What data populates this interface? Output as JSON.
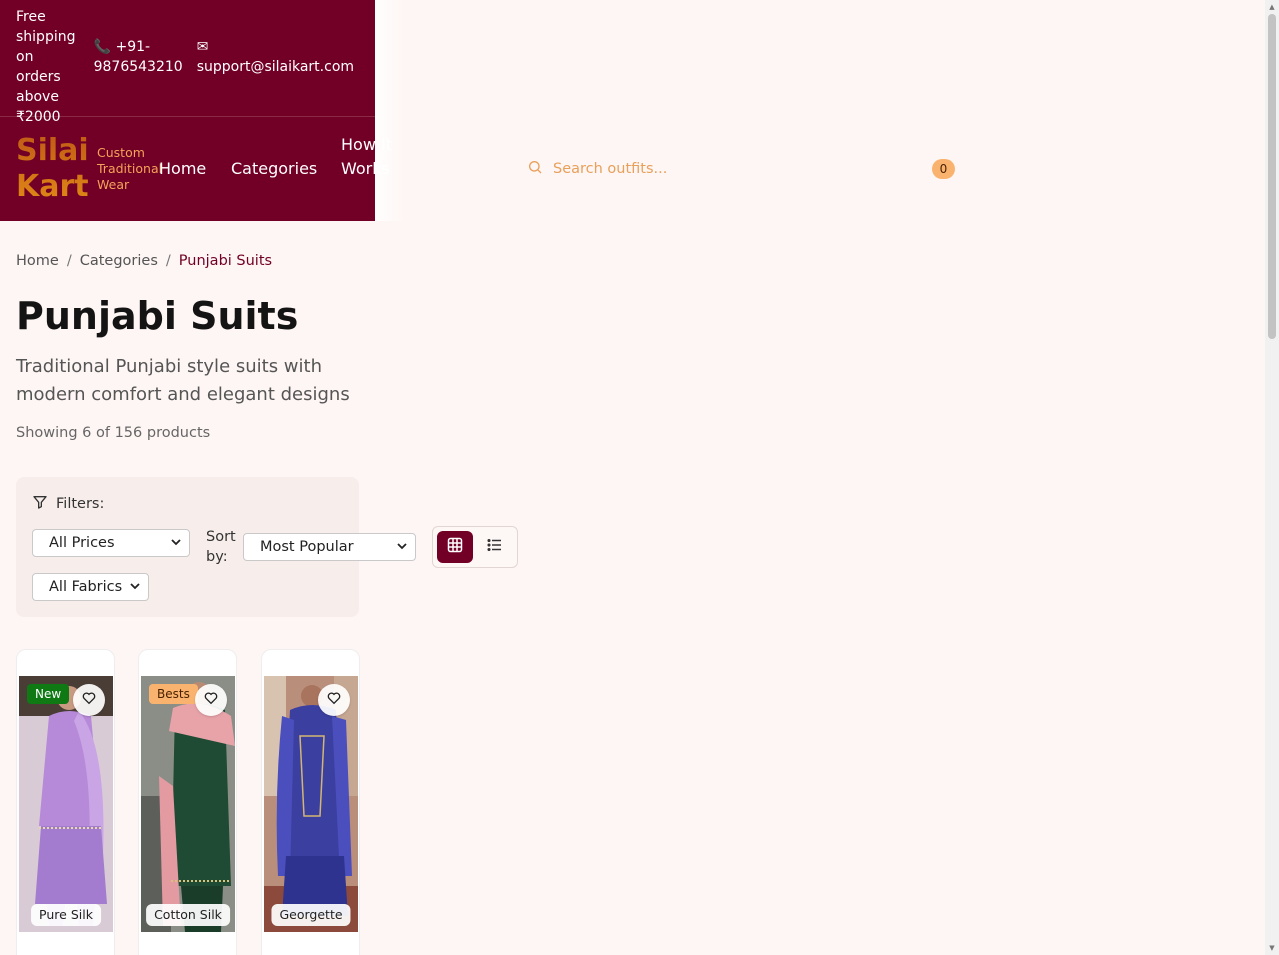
{
  "topbar": {
    "shipping": "Free shipping on orders above ₹2000",
    "phone": "📞 +91-9876543210",
    "email": "✉ support@silaikart.com"
  },
  "brand": {
    "name": "Silai Kart",
    "tagline": "Custom Traditional Wear"
  },
  "nav": {
    "home": "Home",
    "categories": "Categories",
    "how": "How It Works"
  },
  "search": {
    "placeholder": "Search outfits..."
  },
  "cart": {
    "count": "0"
  },
  "breadcrumb": {
    "home": "Home",
    "categories": "Categories",
    "current": "Punjabi Suits",
    "separator": "/"
  },
  "page": {
    "title": "Punjabi Suits",
    "description": "Traditional Punjabi style suits with modern comfort and elegant designs",
    "count": "Showing 6 of 156 products"
  },
  "filters": {
    "label": "Filters:",
    "price": "All Prices",
    "fabric": "All Fabrics",
    "sort_label": "Sort by:",
    "sort": "Most Popular"
  },
  "products": [
    {
      "badge": "New",
      "badge_color": "#0f7a14",
      "fabric": "Pure Silk"
    },
    {
      "badge": "Bests",
      "badge_color": "#f9b36f",
      "fabric": "Cotton Silk"
    },
    {
      "badge": "",
      "badge_color": "",
      "fabric": "Georgette"
    }
  ],
  "colors": {
    "primary": "#720026",
    "accent": "#f9b36f",
    "background": "#fef6f4"
  }
}
